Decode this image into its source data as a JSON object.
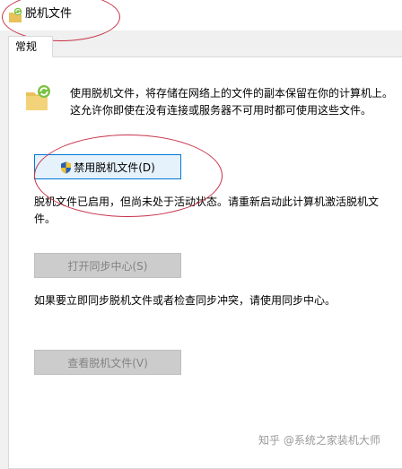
{
  "window": {
    "title": "脱机文件",
    "title_icon": "offline-folder-sync-icon"
  },
  "tabs": [
    {
      "label": "常规",
      "selected": true
    }
  ],
  "general": {
    "description": "使用脱机文件，将存储在网络上的文件的副本保留在你的计算机上。这允许你即使在没有连接或服务器不可用时都可使用这些文件。",
    "disable_button": "禁用脱机文件(D)",
    "disable_button_icon": "uac-shield-icon",
    "status_text": "脱机文件已启用，但尚未处于活动状态。请重新启动此计算机激活脱机文件。",
    "open_sync_button": "打开同步中心(S)",
    "sync_hint": "如果要立即同步脱机文件或者检查同步冲突，请使用同步中心。",
    "view_files_button": "查看脱机文件(V)"
  },
  "watermark": "知乎 @系统之家装机大师",
  "colors": {
    "accent_border": "#0078d7",
    "button_hover_fill": "#e5f1fb",
    "disabled_fill": "#cccccc",
    "annotation": "#c8324a"
  }
}
